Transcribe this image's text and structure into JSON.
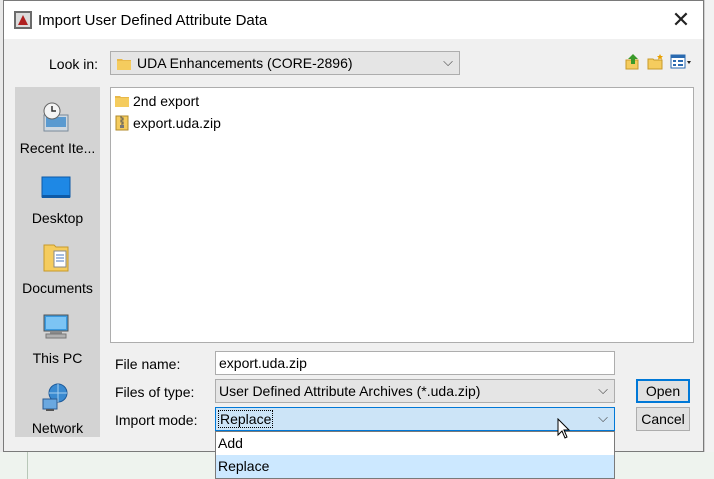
{
  "dialog": {
    "title": "Import User Defined Attribute Data",
    "close_glyph": "✕"
  },
  "look_in": {
    "label": "Look in:",
    "value": "UDA Enhancements (CORE-2896)",
    "chevron": "⌵"
  },
  "toolbar": {
    "icons": [
      "up-folder-icon",
      "new-folder-icon",
      "view-menu-icon"
    ]
  },
  "places": [
    {
      "label": "Recent Ite...",
      "icon": "recent-items-icon"
    },
    {
      "label": "Desktop",
      "icon": "desktop-icon"
    },
    {
      "label": "Documents",
      "icon": "documents-icon"
    },
    {
      "label": "This PC",
      "icon": "this-pc-icon"
    },
    {
      "label": "Network",
      "icon": "network-icon"
    }
  ],
  "files": [
    {
      "name": "2nd export",
      "icon": "folder-icon"
    },
    {
      "name": "export.uda.zip",
      "icon": "zip-file-icon"
    }
  ],
  "form": {
    "file_name_label": "File name:",
    "file_name_value": "export.uda.zip",
    "files_of_type_label": "Files of type:",
    "files_of_type_value": "User Defined Attribute Archives (*.uda.zip)",
    "import_mode_label": "Import mode:",
    "import_mode_value": "Replace"
  },
  "buttons": {
    "open": "Open",
    "cancel": "Cancel"
  },
  "dropdown": {
    "options": [
      "Add",
      "Replace"
    ],
    "selected": "Replace"
  },
  "colors": {
    "accent": "#0078d7",
    "selection": "#cce8ff",
    "places_bg": "#d3d3d3"
  }
}
